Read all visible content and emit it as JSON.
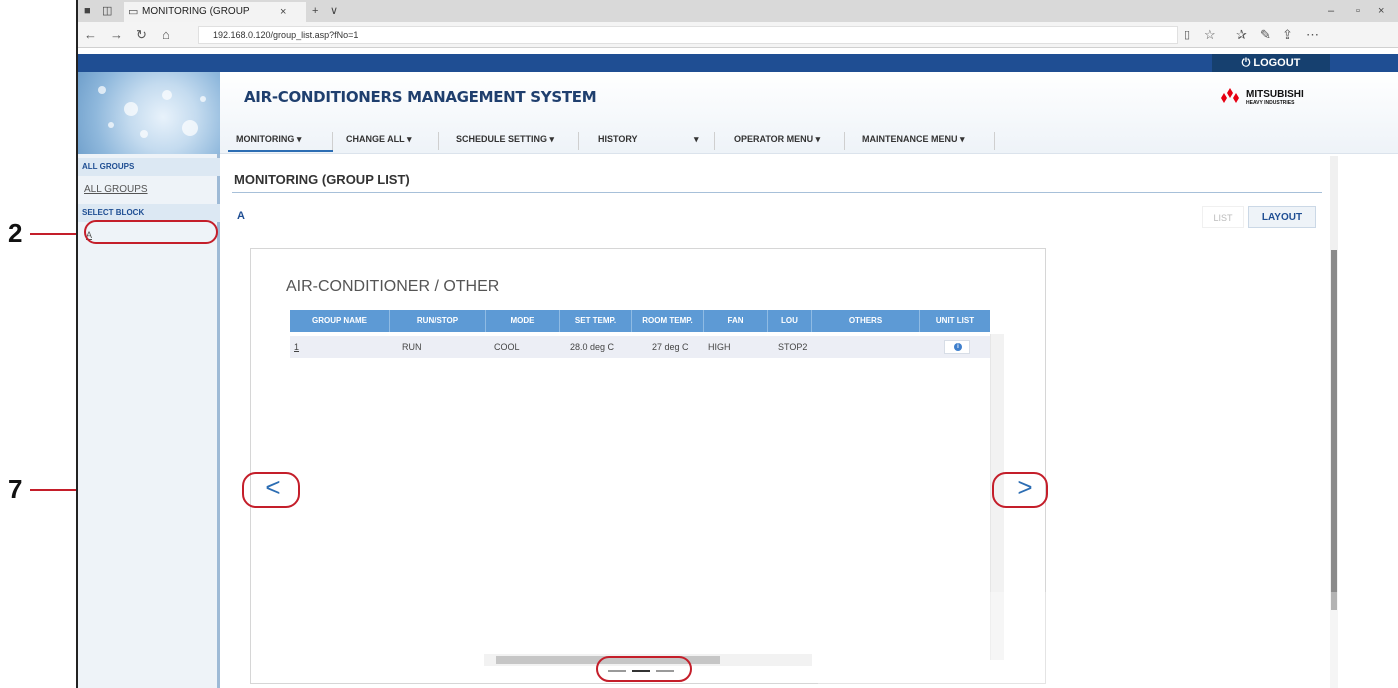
{
  "browser": {
    "tab_title": "MONITORING (GROUP",
    "tab_close": "×",
    "new_tab": "+",
    "tab_menu": "∨",
    "url": "192.168.0.120/group_list.asp?fNo=1",
    "window_min": "–",
    "window_max": "▫",
    "window_close": "×"
  },
  "header": {
    "logout_label": "LOGOUT",
    "app_title": "AIR-CONDITIONERS MANAGEMENT SYSTEM",
    "brand_name": "MITSUBISHI",
    "brand_sub": "HEAVY INDUSTRIES"
  },
  "menu": {
    "items": [
      "MONITORING ▾",
      "CHANGE ALL ▾",
      "SCHEDULE SETTING ▾",
      "HISTORY",
      "▾",
      "OPERATOR MENU ▾",
      "MAINTENANCE MENU ▾"
    ]
  },
  "sidebar": {
    "all_groups_header": "ALL GROUPS",
    "all_groups_link": "ALL GROUPS",
    "select_block_header": "SELECT BLOCK",
    "block_link": "A"
  },
  "main": {
    "page_title": "MONITORING (GROUP LIST)",
    "block_label": "A",
    "list_button": "LIST",
    "layout_button": "LAYOUT",
    "panel_title": "AIR-CONDITIONER / OTHER",
    "prev_arrow": "<",
    "next_arrow": ">"
  },
  "table": {
    "columns": [
      "GROUP NAME",
      "RUN/STOP",
      "MODE",
      "SET TEMP.",
      "ROOM TEMP.",
      "FAN",
      "LOU",
      "OTHERS",
      "UNIT LIST"
    ],
    "rows": [
      {
        "group_name": "1",
        "run_stop": "RUN",
        "mode": "COOL",
        "set_temp": "28.0 deg C",
        "room_temp": "27 deg C",
        "fan": "HIGH",
        "louver": "STOP2",
        "others": "",
        "unit_list_icon": "i"
      }
    ]
  },
  "callouts": {
    "block_select": "2",
    "prev_page": "7",
    "next_page": "7",
    "page_indicator": "7"
  },
  "colors": {
    "accent": "#1f4e93",
    "callout_red": "#c41e2a",
    "grid_header": "#5d9ad5"
  }
}
